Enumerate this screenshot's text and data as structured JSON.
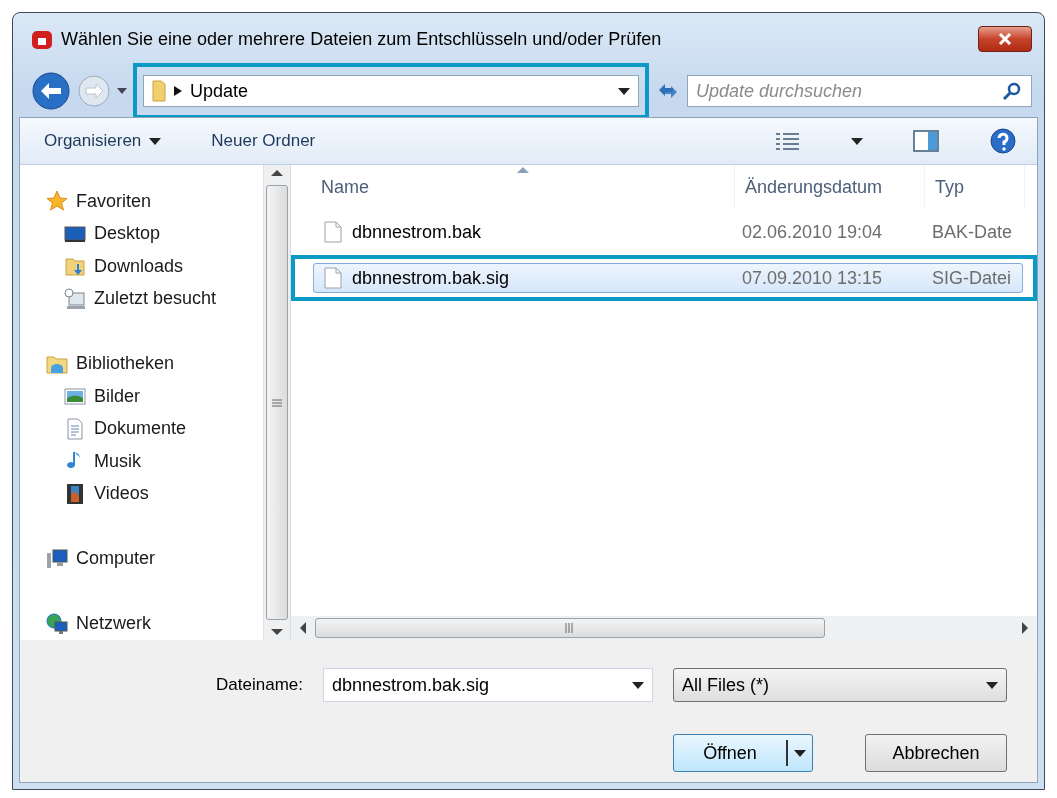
{
  "window": {
    "title": "Wählen Sie eine oder mehrere Dateien zum Entschlüsseln und/oder Prüfen"
  },
  "nav": {
    "address": {
      "crumbs": [
        "Update"
      ],
      "highlighted": true
    },
    "search": {
      "placeholder": "Update durchsuchen"
    }
  },
  "toolbar": {
    "buttons": [
      {
        "label": "Organisieren",
        "menu": true
      },
      {
        "label": "Neuer Ordner",
        "menu": false
      }
    ]
  },
  "sidebar": {
    "groups": [
      {
        "label": "Favoriten",
        "kind": "star",
        "children": [
          {
            "label": "Desktop",
            "kind": "desktop"
          },
          {
            "label": "Downloads",
            "kind": "downloads"
          },
          {
            "label": "Zuletzt besucht",
            "kind": "recent"
          }
        ]
      },
      {
        "label": "Bibliotheken",
        "kind": "library",
        "children": [
          {
            "label": "Bilder",
            "kind": "pictures"
          },
          {
            "label": "Dokumente",
            "kind": "documents"
          },
          {
            "label": "Musik",
            "kind": "music"
          },
          {
            "label": "Videos",
            "kind": "videos"
          }
        ]
      },
      {
        "label": "Computer",
        "kind": "computer"
      },
      {
        "label": "Netzwerk",
        "kind": "network"
      }
    ]
  },
  "table": {
    "columns": [
      "Name",
      "Änderungsdatum",
      "Typ"
    ],
    "rows": [
      {
        "name": "dbnnestrom.bak",
        "date": "02.06.2010 19:04",
        "type": "BAK-Date",
        "selected": false,
        "highlighted": false
      },
      {
        "name": "dbnnestrom.bak.sig",
        "date": "07.09.2010 13:15",
        "type": "SIG-Datei",
        "selected": true,
        "highlighted": true
      }
    ]
  },
  "footer": {
    "filename_label": "Dateiname:",
    "filename": "dbnnestrom.bak.sig",
    "filter": "All Files (*)",
    "buttons": [
      {
        "label": "Öffnen",
        "kind": "split"
      },
      {
        "label": "Abbrechen",
        "kind": "plain"
      }
    ]
  }
}
